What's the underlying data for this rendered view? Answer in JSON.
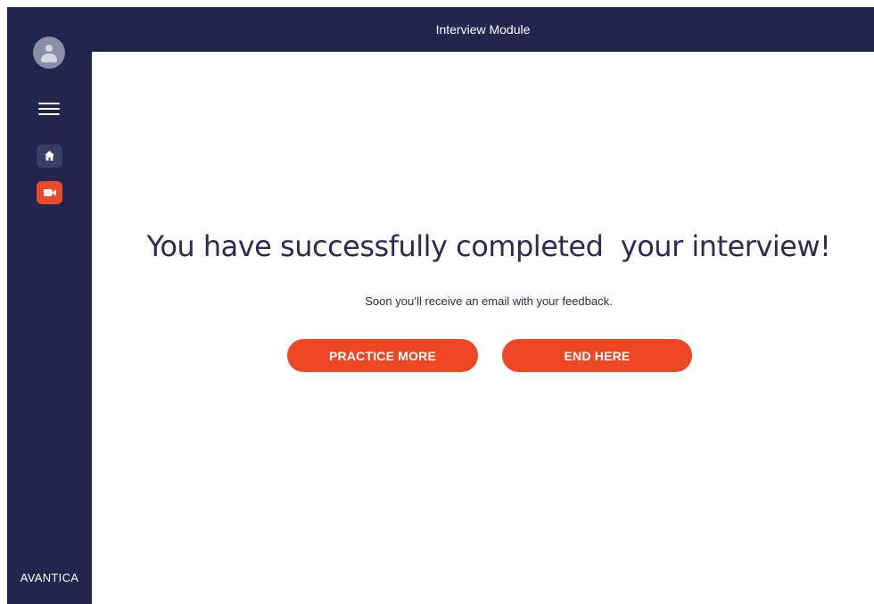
{
  "header": {
    "title": "Interview Module"
  },
  "sidebar": {
    "brand": "AVANTICA",
    "items": [
      {
        "icon": "user-avatar-icon"
      },
      {
        "icon": "hamburger-menu-icon"
      },
      {
        "icon": "home-icon"
      },
      {
        "icon": "video-camera-icon"
      }
    ]
  },
  "main": {
    "headline": "You have successfully completed  your interview!",
    "subtext": "Soon you’ll receive an email with your feedback.",
    "practice_label": "PRACTICE MORE",
    "end_label": "END HERE"
  },
  "colors": {
    "navy": "#22264f",
    "accent": "#ed4726",
    "text": "#2a2d4f"
  }
}
